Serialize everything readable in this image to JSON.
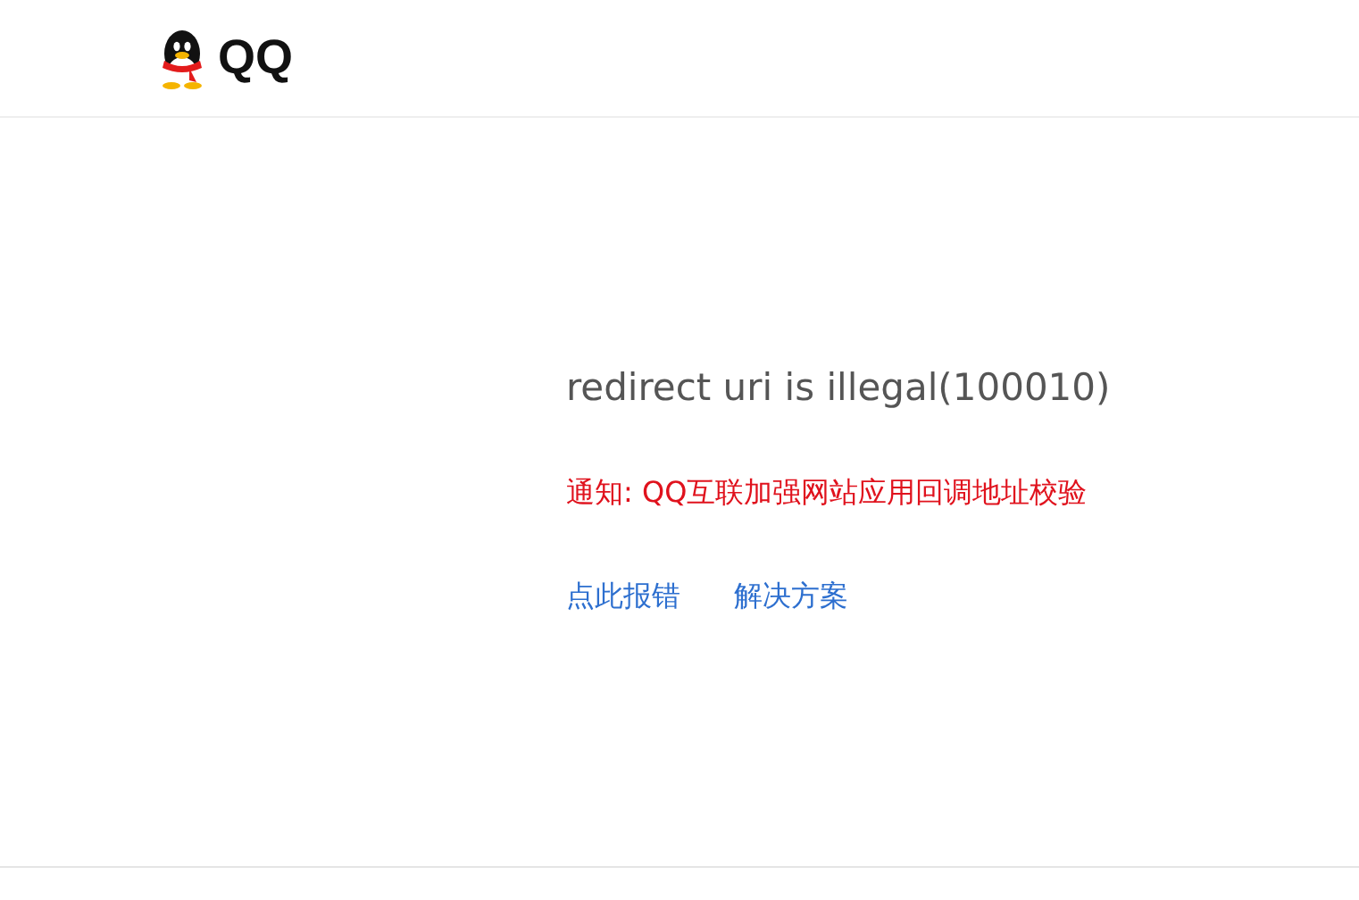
{
  "header": {
    "logo_text": "QQ"
  },
  "error": {
    "message": "redirect uri is illegal(100010)",
    "notice": "通知: QQ互联加强网站应用回调地址校验"
  },
  "links": [
    "点此报错",
    "解决方案"
  ]
}
